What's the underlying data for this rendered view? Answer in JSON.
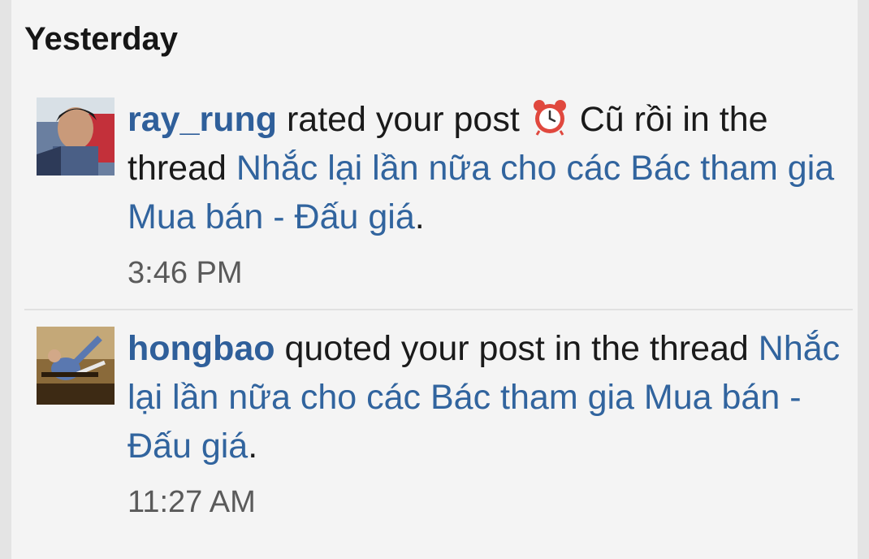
{
  "section_title": "Yesterday",
  "notifications": [
    {
      "user": "ray_rung",
      "action_before": " rated your post ",
      "rating_icon": "alarm-clock-icon",
      "rating_label": " Cũ rồi",
      "action_after": " in the thread ",
      "thread": "Nhắc lại lần nữa cho các Bác tham gia Mua bán - Đấu giá",
      "end": ".",
      "time": "3:46 PM"
    },
    {
      "user": "hongbao",
      "action_before": " quoted your post in the thread ",
      "thread": "Nhắc lại lần nữa cho các Bác tham gia Mua bán - Đấu giá",
      "end": ".",
      "time": "11:27 AM"
    }
  ],
  "colors": {
    "background": "#f4f4f4",
    "link": "#31649e",
    "username": "#2f5f9a",
    "text": "#1a1a1a",
    "timestamp": "#5a5a5a"
  }
}
